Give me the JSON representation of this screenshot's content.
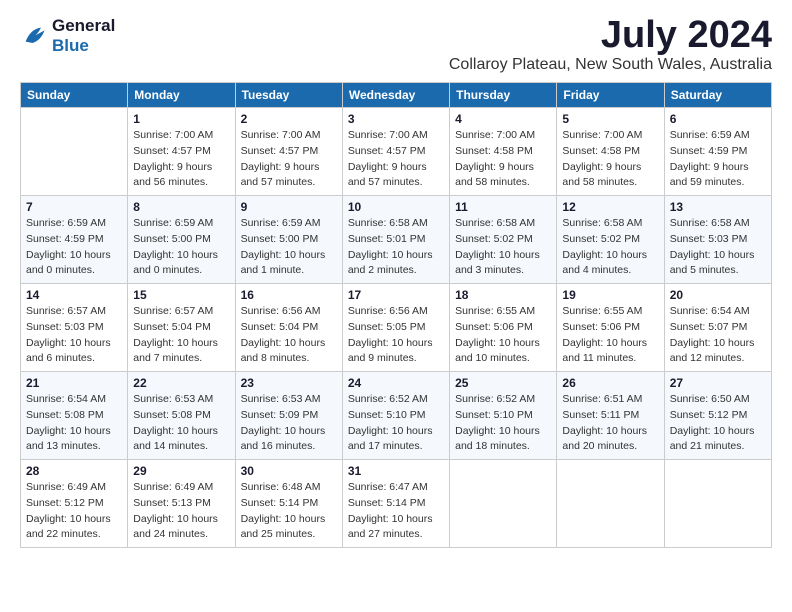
{
  "logo": {
    "line1": "General",
    "line2": "Blue"
  },
  "title": "July 2024",
  "location": "Collaroy Plateau, New South Wales, Australia",
  "weekdays": [
    "Sunday",
    "Monday",
    "Tuesday",
    "Wednesday",
    "Thursday",
    "Friday",
    "Saturday"
  ],
  "weeks": [
    [
      {
        "day": "",
        "sunrise": "",
        "sunset": "",
        "daylight": ""
      },
      {
        "day": "1",
        "sunrise": "Sunrise: 7:00 AM",
        "sunset": "Sunset: 4:57 PM",
        "daylight": "Daylight: 9 hours and 56 minutes."
      },
      {
        "day": "2",
        "sunrise": "Sunrise: 7:00 AM",
        "sunset": "Sunset: 4:57 PM",
        "daylight": "Daylight: 9 hours and 57 minutes."
      },
      {
        "day": "3",
        "sunrise": "Sunrise: 7:00 AM",
        "sunset": "Sunset: 4:57 PM",
        "daylight": "Daylight: 9 hours and 57 minutes."
      },
      {
        "day": "4",
        "sunrise": "Sunrise: 7:00 AM",
        "sunset": "Sunset: 4:58 PM",
        "daylight": "Daylight: 9 hours and 58 minutes."
      },
      {
        "day": "5",
        "sunrise": "Sunrise: 7:00 AM",
        "sunset": "Sunset: 4:58 PM",
        "daylight": "Daylight: 9 hours and 58 minutes."
      },
      {
        "day": "6",
        "sunrise": "Sunrise: 6:59 AM",
        "sunset": "Sunset: 4:59 PM",
        "daylight": "Daylight: 9 hours and 59 minutes."
      }
    ],
    [
      {
        "day": "7",
        "sunrise": "Sunrise: 6:59 AM",
        "sunset": "Sunset: 4:59 PM",
        "daylight": "Daylight: 10 hours and 0 minutes."
      },
      {
        "day": "8",
        "sunrise": "Sunrise: 6:59 AM",
        "sunset": "Sunset: 5:00 PM",
        "daylight": "Daylight: 10 hours and 0 minutes."
      },
      {
        "day": "9",
        "sunrise": "Sunrise: 6:59 AM",
        "sunset": "Sunset: 5:00 PM",
        "daylight": "Daylight: 10 hours and 1 minute."
      },
      {
        "day": "10",
        "sunrise": "Sunrise: 6:58 AM",
        "sunset": "Sunset: 5:01 PM",
        "daylight": "Daylight: 10 hours and 2 minutes."
      },
      {
        "day": "11",
        "sunrise": "Sunrise: 6:58 AM",
        "sunset": "Sunset: 5:02 PM",
        "daylight": "Daylight: 10 hours and 3 minutes."
      },
      {
        "day": "12",
        "sunrise": "Sunrise: 6:58 AM",
        "sunset": "Sunset: 5:02 PM",
        "daylight": "Daylight: 10 hours and 4 minutes."
      },
      {
        "day": "13",
        "sunrise": "Sunrise: 6:58 AM",
        "sunset": "Sunset: 5:03 PM",
        "daylight": "Daylight: 10 hours and 5 minutes."
      }
    ],
    [
      {
        "day": "14",
        "sunrise": "Sunrise: 6:57 AM",
        "sunset": "Sunset: 5:03 PM",
        "daylight": "Daylight: 10 hours and 6 minutes."
      },
      {
        "day": "15",
        "sunrise": "Sunrise: 6:57 AM",
        "sunset": "Sunset: 5:04 PM",
        "daylight": "Daylight: 10 hours and 7 minutes."
      },
      {
        "day": "16",
        "sunrise": "Sunrise: 6:56 AM",
        "sunset": "Sunset: 5:04 PM",
        "daylight": "Daylight: 10 hours and 8 minutes."
      },
      {
        "day": "17",
        "sunrise": "Sunrise: 6:56 AM",
        "sunset": "Sunset: 5:05 PM",
        "daylight": "Daylight: 10 hours and 9 minutes."
      },
      {
        "day": "18",
        "sunrise": "Sunrise: 6:55 AM",
        "sunset": "Sunset: 5:06 PM",
        "daylight": "Daylight: 10 hours and 10 minutes."
      },
      {
        "day": "19",
        "sunrise": "Sunrise: 6:55 AM",
        "sunset": "Sunset: 5:06 PM",
        "daylight": "Daylight: 10 hours and 11 minutes."
      },
      {
        "day": "20",
        "sunrise": "Sunrise: 6:54 AM",
        "sunset": "Sunset: 5:07 PM",
        "daylight": "Daylight: 10 hours and 12 minutes."
      }
    ],
    [
      {
        "day": "21",
        "sunrise": "Sunrise: 6:54 AM",
        "sunset": "Sunset: 5:08 PM",
        "daylight": "Daylight: 10 hours and 13 minutes."
      },
      {
        "day": "22",
        "sunrise": "Sunrise: 6:53 AM",
        "sunset": "Sunset: 5:08 PM",
        "daylight": "Daylight: 10 hours and 14 minutes."
      },
      {
        "day": "23",
        "sunrise": "Sunrise: 6:53 AM",
        "sunset": "Sunset: 5:09 PM",
        "daylight": "Daylight: 10 hours and 16 minutes."
      },
      {
        "day": "24",
        "sunrise": "Sunrise: 6:52 AM",
        "sunset": "Sunset: 5:10 PM",
        "daylight": "Daylight: 10 hours and 17 minutes."
      },
      {
        "day": "25",
        "sunrise": "Sunrise: 6:52 AM",
        "sunset": "Sunset: 5:10 PM",
        "daylight": "Daylight: 10 hours and 18 minutes."
      },
      {
        "day": "26",
        "sunrise": "Sunrise: 6:51 AM",
        "sunset": "Sunset: 5:11 PM",
        "daylight": "Daylight: 10 hours and 20 minutes."
      },
      {
        "day": "27",
        "sunrise": "Sunrise: 6:50 AM",
        "sunset": "Sunset: 5:12 PM",
        "daylight": "Daylight: 10 hours and 21 minutes."
      }
    ],
    [
      {
        "day": "28",
        "sunrise": "Sunrise: 6:49 AM",
        "sunset": "Sunset: 5:12 PM",
        "daylight": "Daylight: 10 hours and 22 minutes."
      },
      {
        "day": "29",
        "sunrise": "Sunrise: 6:49 AM",
        "sunset": "Sunset: 5:13 PM",
        "daylight": "Daylight: 10 hours and 24 minutes."
      },
      {
        "day": "30",
        "sunrise": "Sunrise: 6:48 AM",
        "sunset": "Sunset: 5:14 PM",
        "daylight": "Daylight: 10 hours and 25 minutes."
      },
      {
        "day": "31",
        "sunrise": "Sunrise: 6:47 AM",
        "sunset": "Sunset: 5:14 PM",
        "daylight": "Daylight: 10 hours and 27 minutes."
      },
      {
        "day": "",
        "sunrise": "",
        "sunset": "",
        "daylight": ""
      },
      {
        "day": "",
        "sunrise": "",
        "sunset": "",
        "daylight": ""
      },
      {
        "day": "",
        "sunrise": "",
        "sunset": "",
        "daylight": ""
      }
    ]
  ]
}
